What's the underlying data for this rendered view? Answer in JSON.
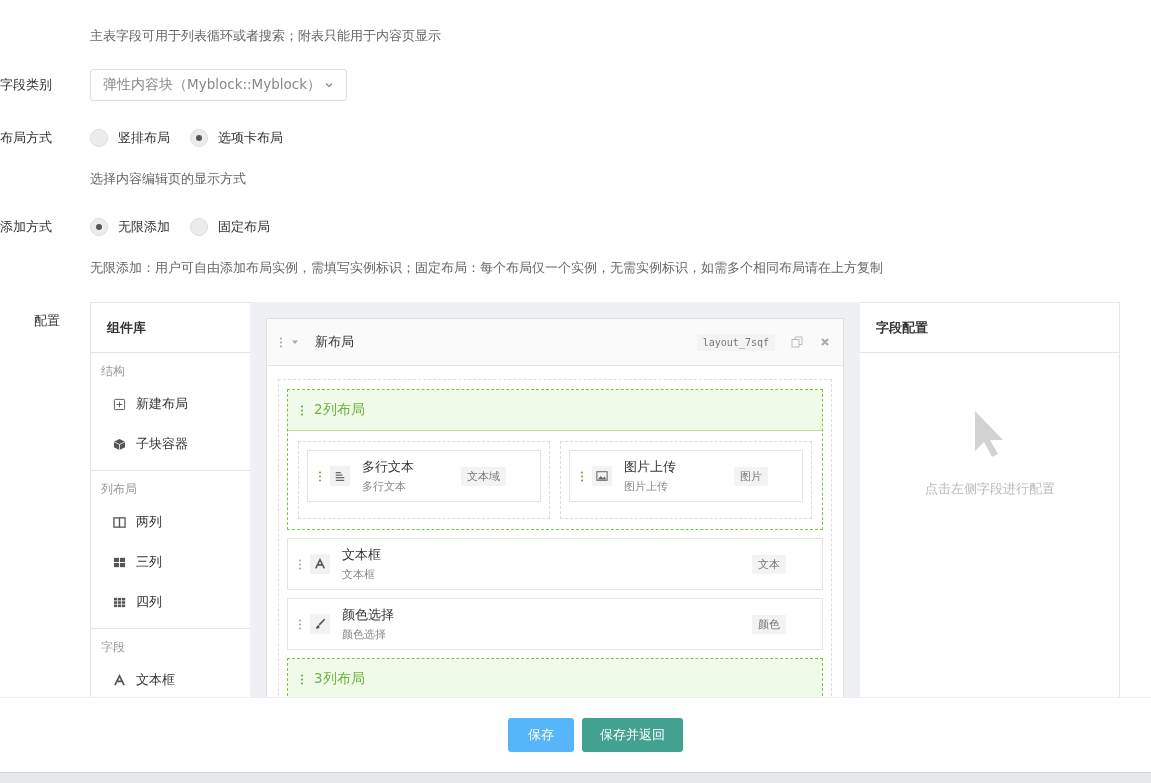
{
  "hint_top": "主表字段可用于列表循环或者搜索；附表只能用于内容页显示",
  "field_type": {
    "label": "字段类别",
    "value": "弹性内容块（Myblock::Myblock）"
  },
  "layout_mode": {
    "label": "布局方式",
    "options": [
      {
        "label": "竖排布局",
        "selected": false
      },
      {
        "label": "选项卡布局",
        "selected": true
      }
    ],
    "hint": "选择内容编辑页的显示方式"
  },
  "add_mode": {
    "label": "添加方式",
    "options": [
      {
        "label": "无限添加",
        "selected": true
      },
      {
        "label": "固定布局",
        "selected": false
      }
    ],
    "hint": "无限添加：用户可自由添加布局实例，需填写实例标识；固定布局：每个布局仅一个实例，无需实例标识，如需多个相同布局请在上方复制"
  },
  "config": {
    "label": "配置",
    "library": {
      "title": "组件库",
      "groups": [
        {
          "title": "结构",
          "items": [
            {
              "label": "新建布局"
            },
            {
              "label": "子块容器"
            }
          ]
        },
        {
          "title": "列布局",
          "items": [
            {
              "label": "两列"
            },
            {
              "label": "三列"
            },
            {
              "label": "四列"
            }
          ]
        },
        {
          "title": "字段",
          "items": [
            {
              "label": "文本框"
            }
          ]
        }
      ]
    },
    "canvas": {
      "layout": {
        "title": "新布局",
        "key": "layout_7sqf",
        "blocks": [
          {
            "kind": "columns",
            "title": "2列布局",
            "columns": [
              {
                "fields": [
                  {
                    "title": "多行文本",
                    "subtitle": "多行文本",
                    "tag": "文本域"
                  }
                ]
              },
              {
                "fields": [
                  {
                    "title": "图片上传",
                    "subtitle": "图片上传",
                    "tag": "图片"
                  }
                ]
              }
            ]
          },
          {
            "kind": "field",
            "title": "文本框",
            "subtitle": "文本框",
            "tag": "文本"
          },
          {
            "kind": "field",
            "title": "颜色选择",
            "subtitle": "颜色选择",
            "tag": "颜色"
          },
          {
            "kind": "columns",
            "title": "3列布局"
          }
        ]
      }
    },
    "settings": {
      "title": "字段配置",
      "empty_text": "点击左侧字段进行配置"
    }
  },
  "buttons": [
    {
      "label": "保存",
      "kind": "primary"
    },
    {
      "label": "保存并返回",
      "kind": "success"
    }
  ]
}
